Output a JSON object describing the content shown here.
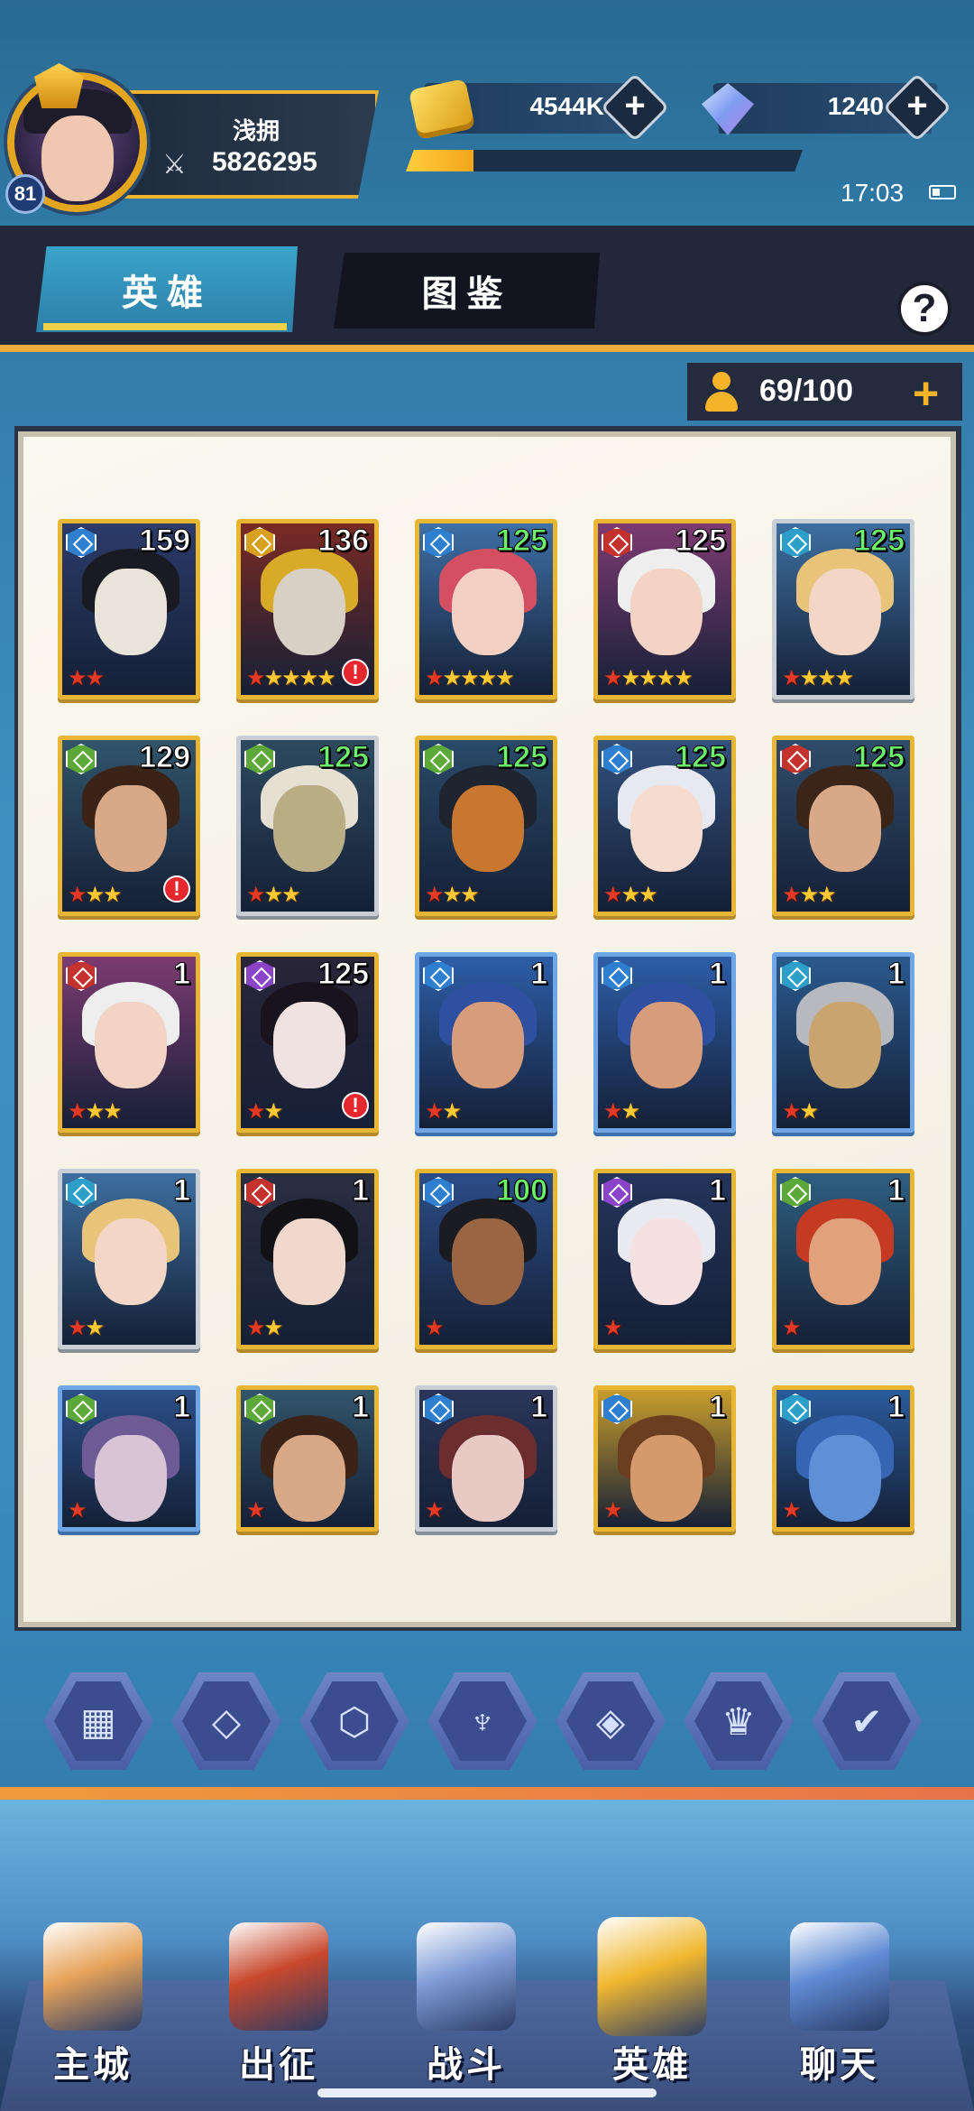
{
  "player": {
    "name": "浅拥",
    "level": "81",
    "power": "5826295"
  },
  "resources": {
    "gold": "4544K",
    "gems": "1240",
    "xp_fraction": 0.17
  },
  "status": {
    "time": "17:03"
  },
  "tabs": {
    "heroes": "英雄",
    "codex": "图鉴"
  },
  "help": {
    "label": "?"
  },
  "capacity": {
    "text": "69/100",
    "plus": "+"
  },
  "colors": {
    "blue_faction": "#2f7fd0",
    "gold_faction": "#d9a020",
    "red_faction": "#c3322d",
    "green_faction": "#5ca93a",
    "purple_faction": "#8b43c7",
    "teal_faction": "#2c9fc9"
  },
  "heroes": [
    {
      "level": "159",
      "green": false,
      "stars": [
        "r",
        "r"
      ],
      "faction": "blue_faction",
      "alert": false,
      "frame": "gold",
      "skin": "#e9e4da",
      "hair": "#1a1a22",
      "bg": "#2b3b6a"
    },
    {
      "level": "136",
      "green": false,
      "stars": [
        "r",
        "g",
        "g",
        "g",
        "g"
      ],
      "faction": "gold_faction",
      "alert": true,
      "frame": "gold",
      "skin": "#d8d0c4",
      "hair": "#d9a928",
      "bg": "#7a2a24"
    },
    {
      "level": "125",
      "green": true,
      "stars": [
        "r",
        "g",
        "g",
        "g",
        "g"
      ],
      "faction": "blue_faction",
      "alert": false,
      "frame": "gold",
      "skin": "#f3d0c1",
      "hair": "#d44f5f",
      "bg": "#3e6fa6"
    },
    {
      "level": "125",
      "green": false,
      "stars": [
        "r",
        "g",
        "g",
        "g",
        "g"
      ],
      "faction": "red_faction",
      "alert": false,
      "frame": "gold",
      "skin": "#f2d3c4",
      "hair": "#eeeeee",
      "bg": "#7d3b72"
    },
    {
      "level": "125",
      "green": true,
      "stars": [
        "r",
        "g",
        "g",
        "g"
      ],
      "faction": "teal_faction",
      "alert": false,
      "frame": "silver",
      "skin": "#f4d6c6",
      "hair": "#e7c47a",
      "bg": "#3d6fa0"
    },
    {
      "level": "129",
      "green": false,
      "stars": [
        "r",
        "g",
        "g"
      ],
      "faction": "green_faction",
      "alert": true,
      "frame": "gold",
      "skin": "#d9a987",
      "hair": "#3b2417",
      "bg": "#31556b"
    },
    {
      "level": "125",
      "green": true,
      "stars": [
        "r",
        "g",
        "g"
      ],
      "faction": "green_faction",
      "alert": false,
      "frame": "silver",
      "skin": "#b9ad86",
      "hair": "#e5e0d2",
      "bg": "#2d4a60"
    },
    {
      "level": "125",
      "green": true,
      "stars": [
        "r",
        "g",
        "g"
      ],
      "faction": "green_faction",
      "alert": false,
      "frame": "gold",
      "skin": "#c9772f",
      "hair": "#1f2530",
      "bg": "#294a6a"
    },
    {
      "level": "125",
      "green": true,
      "stars": [
        "r",
        "g",
        "g"
      ],
      "faction": "blue_faction",
      "alert": false,
      "frame": "gold",
      "skin": "#f5dccf",
      "hair": "#e7e9f0",
      "bg": "#32507d"
    },
    {
      "level": "125",
      "green": true,
      "stars": [
        "r",
        "g",
        "g"
      ],
      "faction": "red_faction",
      "alert": false,
      "frame": "gold",
      "skin": "#d9a888",
      "hair": "#3b2519",
      "bg": "#2f4c6a"
    },
    {
      "level": "1",
      "green": false,
      "stars": [
        "r",
        "g",
        "g"
      ],
      "faction": "red_faction",
      "alert": false,
      "frame": "gold",
      "skin": "#f2d3c4",
      "hair": "#eeeeee",
      "bg": "#7d3b72"
    },
    {
      "level": "125",
      "green": false,
      "stars": [
        "r",
        "g"
      ],
      "faction": "purple_faction",
      "alert": true,
      "frame": "gold",
      "skin": "#f0e2e0",
      "hair": "#18131d",
      "bg": "#2a2538"
    },
    {
      "level": "1",
      "green": false,
      "stars": [
        "r",
        "g"
      ],
      "faction": "blue_faction",
      "alert": false,
      "frame": "blue",
      "skin": "#d79c79",
      "hair": "#2f4fa0",
      "bg": "#2d5ea8"
    },
    {
      "level": "1",
      "green": false,
      "stars": [
        "r",
        "g"
      ],
      "faction": "blue_faction",
      "alert": false,
      "frame": "blue",
      "skin": "#d79c79",
      "hair": "#2f4fa0",
      "bg": "#2d5ea8"
    },
    {
      "level": "1",
      "green": false,
      "stars": [
        "r",
        "g"
      ],
      "faction": "teal_faction",
      "alert": false,
      "frame": "blue",
      "skin": "#c9a46f",
      "hair": "#b7b9bf",
      "bg": "#2a5a8e"
    },
    {
      "level": "1",
      "green": false,
      "stars": [
        "r",
        "g"
      ],
      "faction": "teal_faction",
      "alert": false,
      "frame": "silver",
      "skin": "#f4d6c6",
      "hair": "#e7c47a",
      "bg": "#3d6fa0"
    },
    {
      "level": "1",
      "green": false,
      "stars": [
        "r",
        "g"
      ],
      "faction": "red_faction",
      "alert": false,
      "frame": "gold",
      "skin": "#f0d9cc",
      "hair": "#121216",
      "bg": "#2a2f40"
    },
    {
      "level": "100",
      "green": true,
      "stars": [
        "r"
      ],
      "faction": "blue_faction",
      "alert": false,
      "frame": "gold",
      "skin": "#9a6543",
      "hair": "#1b1b22",
      "bg": "#2b4d88"
    },
    {
      "level": "1",
      "green": false,
      "stars": [
        "r"
      ],
      "faction": "purple_faction",
      "alert": false,
      "frame": "gold",
      "skin": "#f5e1e1",
      "hair": "#e9eaf0",
      "bg": "#24345c"
    },
    {
      "level": "1",
      "green": false,
      "stars": [
        "r"
      ],
      "faction": "green_faction",
      "alert": false,
      "frame": "gold",
      "skin": "#e1a17a",
      "hair": "#c43a23",
      "bg": "#2e5f80"
    },
    {
      "level": "1",
      "green": false,
      "stars": [
        "r"
      ],
      "faction": "green_faction",
      "alert": false,
      "frame": "blue",
      "skin": "#d7c5d6",
      "hair": "#6e5b95",
      "bg": "#2b4f88"
    },
    {
      "level": "1",
      "green": false,
      "stars": [
        "r"
      ],
      "faction": "green_faction",
      "alert": false,
      "frame": "gold",
      "skin": "#d9a987",
      "hair": "#3b2417",
      "bg": "#31556b"
    },
    {
      "level": "1",
      "green": false,
      "stars": [
        "r"
      ],
      "faction": "blue_faction",
      "alert": false,
      "frame": "silver",
      "skin": "#e9c9c4",
      "hair": "#6c2d2f",
      "bg": "#2b3558"
    },
    {
      "level": "1",
      "green": false,
      "stars": [
        "r"
      ],
      "faction": "blue_faction",
      "alert": false,
      "frame": "gold",
      "skin": "#d59a6c",
      "hair": "#6b3e22",
      "bg": "#c99d2c"
    },
    {
      "level": "1",
      "green": false,
      "stars": [
        "r"
      ],
      "faction": "teal_faction",
      "alert": false,
      "frame": "gold",
      "skin": "#5f8fd6",
      "hair": "#3565b3",
      "bg": "#2a5b9c"
    }
  ],
  "filters": [
    {
      "icon": "grid-icon",
      "glyph": "▦"
    },
    {
      "icon": "blade-faction-icon",
      "glyph": "◇"
    },
    {
      "icon": "shield-faction-icon",
      "glyph": "⬡"
    },
    {
      "icon": "crest-faction-icon",
      "glyph": "♆"
    },
    {
      "icon": "beast-faction-icon",
      "glyph": "◈"
    },
    {
      "icon": "crown-faction-icon",
      "glyph": "♛"
    },
    {
      "icon": "chevron-faction-icon",
      "glyph": "✔"
    }
  ],
  "nav": [
    {
      "label": "主城",
      "icon": "city-book-icon",
      "color": "#e7a35a"
    },
    {
      "label": "出征",
      "icon": "ship-icon",
      "color": "#c8482d"
    },
    {
      "label": "战斗",
      "icon": "crossed-swords-icon",
      "color": "#7f9bd6"
    },
    {
      "label": "英雄",
      "icon": "hero-helmet-icon",
      "color": "#f0b72f"
    },
    {
      "label": "聊天",
      "icon": "chat-pin-icon",
      "color": "#5f8bd4"
    }
  ]
}
